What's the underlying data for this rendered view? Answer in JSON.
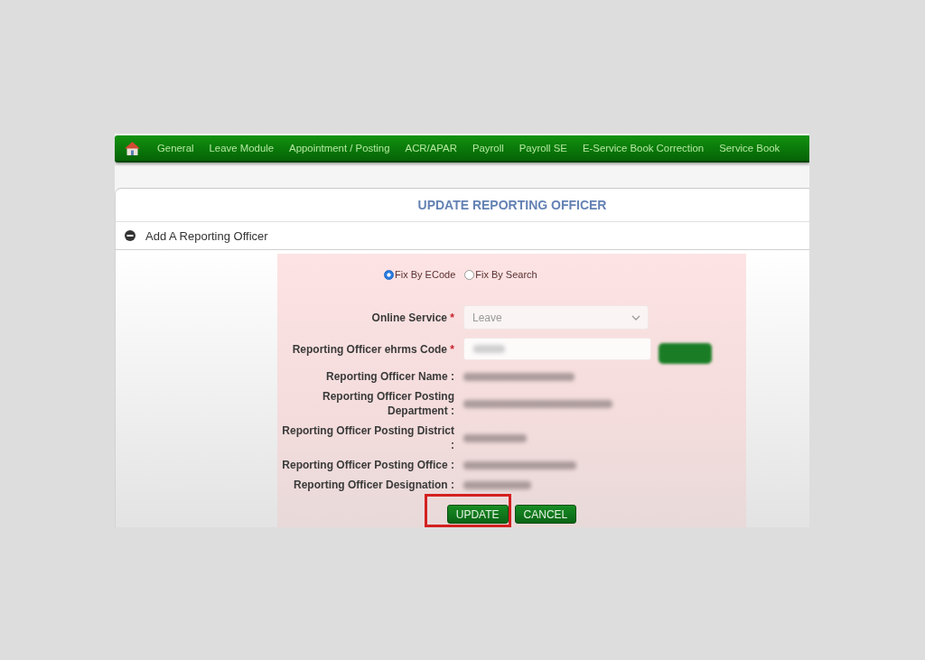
{
  "nav_items": [
    "General",
    "Leave Module",
    "Appointment / Posting",
    "ACR/APAR",
    "Payroll",
    "Payroll SE",
    "E-Service Book Correction",
    "Service Book"
  ],
  "page_title": "UPDATE REPORTING OFFICER",
  "section": {
    "title": "Add A Reporting Officer",
    "expanded": true
  },
  "mode_options": [
    {
      "label": "Fix By ECode",
      "selected": true
    },
    {
      "label": "Fix By Search",
      "selected": false
    }
  ],
  "fields": [
    {
      "kind": "select",
      "label": "Online Service",
      "required_mark": "*",
      "value": "Leave",
      "disabled": true
    },
    {
      "kind": "code_input",
      "label": "Reporting Officer ehrms Code",
      "required_mark": "*"
    },
    {
      "kind": "readout",
      "label": "Reporting Officer Name :"
    },
    {
      "kind": "readout",
      "label": "Reporting Officer Posting Department :"
    },
    {
      "kind": "readout",
      "label": "Reporting Officer Posting District :"
    },
    {
      "kind": "readout",
      "label": "Reporting Officer Posting Office :"
    },
    {
      "kind": "readout",
      "label": "Reporting Officer Designation :"
    }
  ],
  "buttons": [
    {
      "label": "UPDATE",
      "highlighted": true
    },
    {
      "label": "CANCEL",
      "highlighted": false
    }
  ]
}
